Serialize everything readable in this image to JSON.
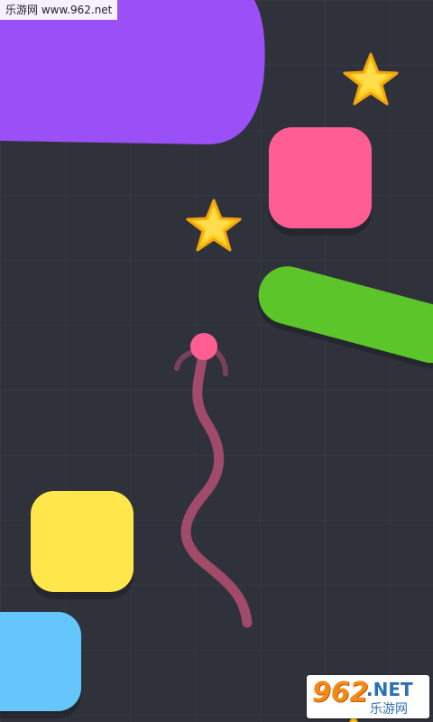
{
  "watermark": "乐游网 www.962.net",
  "logo": {
    "number": "962",
    "suffix": ".NET",
    "chinese": "乐游网"
  },
  "colors": {
    "background": "#2f323b",
    "purple_block": "#9b50f7",
    "pink_block": "#ff5d94",
    "green_bar": "#5cc52a",
    "yellow_block": "#ffe64b",
    "blue_block": "#64c6fa",
    "snake": "#ff5e90",
    "star": "#ffd21f"
  },
  "objects": {
    "stars": [
      "star-top-right",
      "star-center",
      "star-bottom-partial"
    ],
    "blocks": [
      "purple-block",
      "pink-square",
      "green-bar",
      "yellow-square",
      "blue-square"
    ],
    "player": "snake-head"
  }
}
